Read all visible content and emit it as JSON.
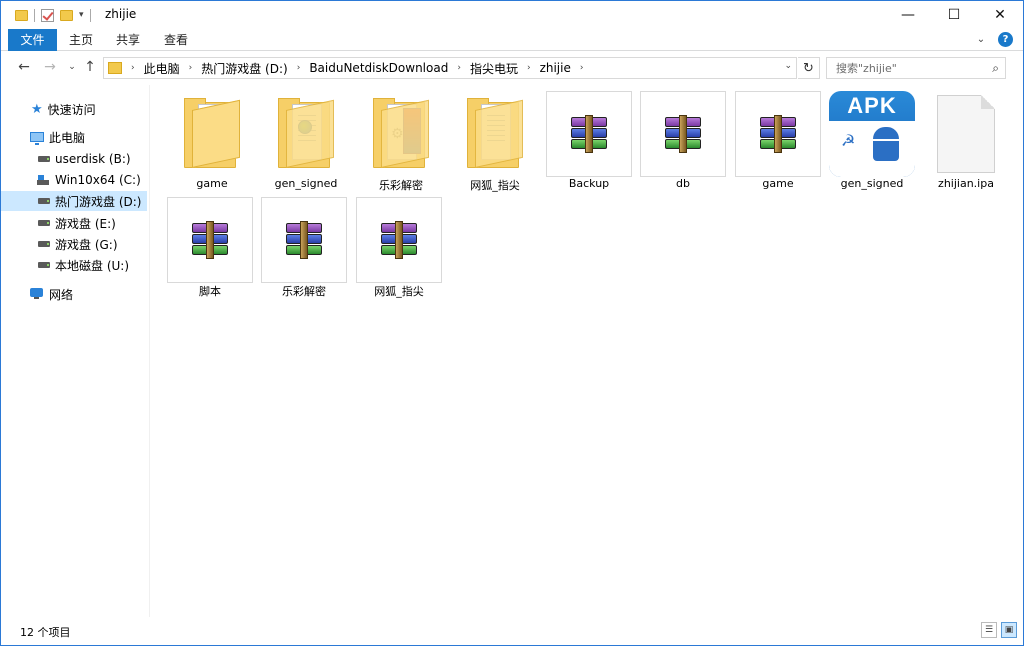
{
  "window": {
    "title": "zhijie",
    "controls": {
      "minimize": "—",
      "maximize": "☐",
      "close": "✕"
    }
  },
  "ribbon": {
    "tabs": [
      "文件",
      "主页",
      "共享",
      "查看"
    ]
  },
  "address": {
    "crumbs": [
      "此电脑",
      "热门游戏盘 (D:)",
      "BaiduNetdiskDownload",
      "指尖电玩",
      "zhijie"
    ],
    "search_placeholder": "搜索\"zhijie\""
  },
  "nav": {
    "items": [
      {
        "label": "快速访问",
        "icon": "star-icon"
      },
      {
        "label": "此电脑",
        "icon": "computer-icon"
      },
      {
        "label": "userdisk (B:)",
        "icon": "drive-icon"
      },
      {
        "label": "Win10x64 (C:)",
        "icon": "windows-drive-icon"
      },
      {
        "label": "热门游戏盘 (D:)",
        "icon": "drive-icon",
        "selected": true
      },
      {
        "label": "游戏盘 (E:)",
        "icon": "drive-icon"
      },
      {
        "label": "游戏盘 (G:)",
        "icon": "drive-icon"
      },
      {
        "label": "本地磁盘 (U:)",
        "icon": "drive-icon"
      },
      {
        "label": "网络",
        "icon": "network-icon"
      }
    ]
  },
  "files": [
    {
      "name": "game",
      "type": "folder"
    },
    {
      "name": "gen_signed",
      "type": "folder"
    },
    {
      "name": "乐彩解密",
      "type": "folder"
    },
    {
      "name": "网狐_指尖",
      "type": "folder"
    },
    {
      "name": "Backup",
      "type": "rar"
    },
    {
      "name": "db",
      "type": "rar"
    },
    {
      "name": "game",
      "type": "rar"
    },
    {
      "name": "gen_signed",
      "type": "apk"
    },
    {
      "name": "zhijian.ipa",
      "type": "ipa"
    },
    {
      "name": "脚本",
      "type": "rar"
    },
    {
      "name": "乐彩解密",
      "type": "rar"
    },
    {
      "name": "网狐_指尖",
      "type": "rar"
    }
  ],
  "apk_badge": "APK",
  "status": {
    "count": "12 个项目"
  },
  "colors": {
    "accent": "#1979ca",
    "selection": "#cce8ff",
    "folder": "#f6cf67"
  }
}
